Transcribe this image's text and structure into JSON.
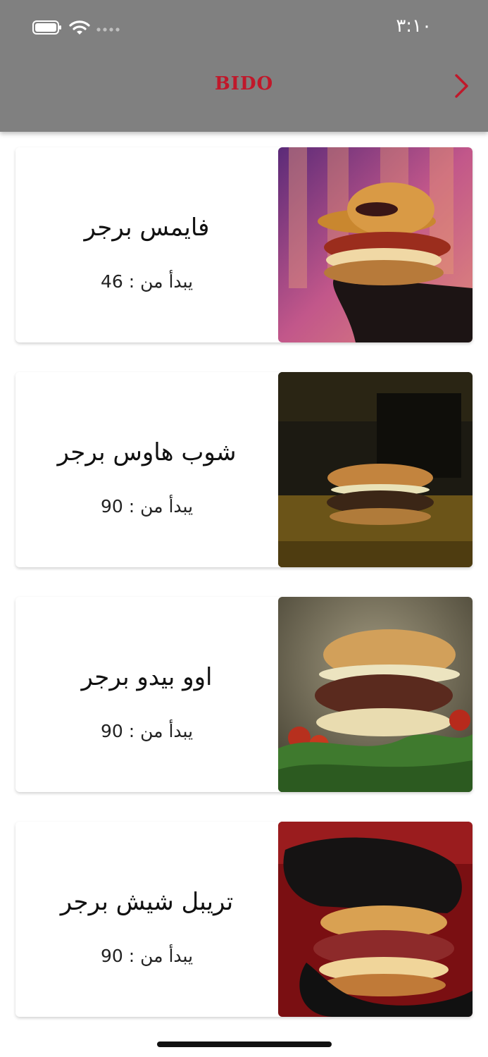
{
  "status_bar": {
    "time": "٣:١٠"
  },
  "header": {
    "brand": "BIDO",
    "back_icon": "chevron-right-icon"
  },
  "colors": {
    "header_bg": "#808080",
    "brand": "#c0182a"
  },
  "items": [
    {
      "title": "فايمس برجر",
      "price_label": "يبدأ من : 46"
    },
    {
      "title": "شوب هاوس برجر",
      "price_label": "يبدأ من : 90"
    },
    {
      "title": "اوو بيدو برجر",
      "price_label": "يبدأ من : 90"
    },
    {
      "title": "تريبل شيش برجر",
      "price_label": "يبدأ من : 90"
    }
  ]
}
